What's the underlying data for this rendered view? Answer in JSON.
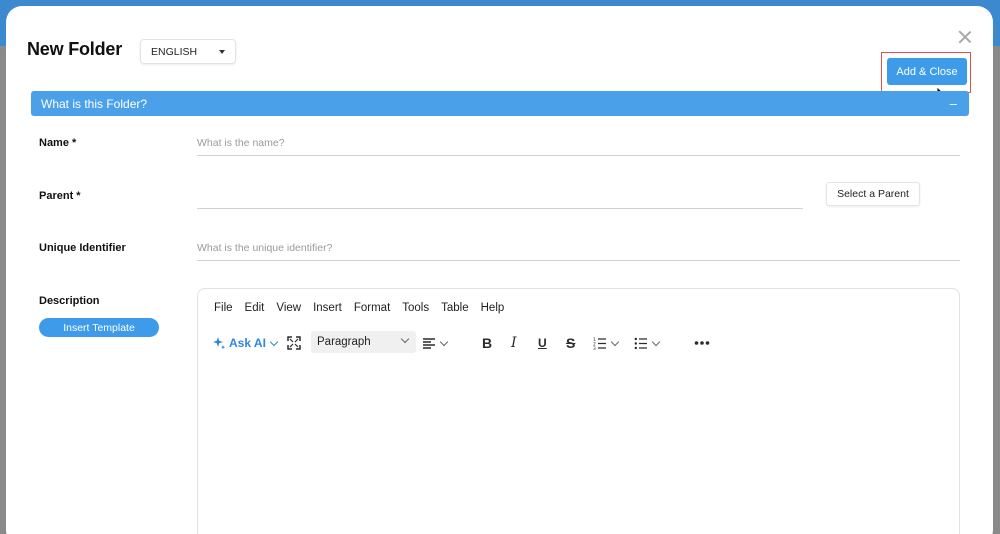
{
  "modal": {
    "title": "New Folder",
    "language": "ENGLISH",
    "add_close_label": "Add & Close"
  },
  "section": {
    "title": "What is this Folder?",
    "collapse_symbol": "–"
  },
  "fields": {
    "name_label": "Name *",
    "name_placeholder": "What is the name?",
    "parent_label": "Parent  *",
    "parent_value": "",
    "select_parent_label": "Select a Parent",
    "uid_label": "Unique Identifier",
    "uid_placeholder": "What is the unique identifier?",
    "description_label": "Description",
    "insert_template_label": "Insert Template"
  },
  "editor": {
    "menus": [
      "File",
      "Edit",
      "View",
      "Insert",
      "Format",
      "Tools",
      "Table",
      "Help"
    ],
    "ask_ai_label": "Ask AI",
    "block_format": "Paragraph",
    "content": ""
  },
  "colors": {
    "accent": "#3d9be9",
    "section_bar": "#4aa1ea",
    "highlight": "#e0524a"
  }
}
